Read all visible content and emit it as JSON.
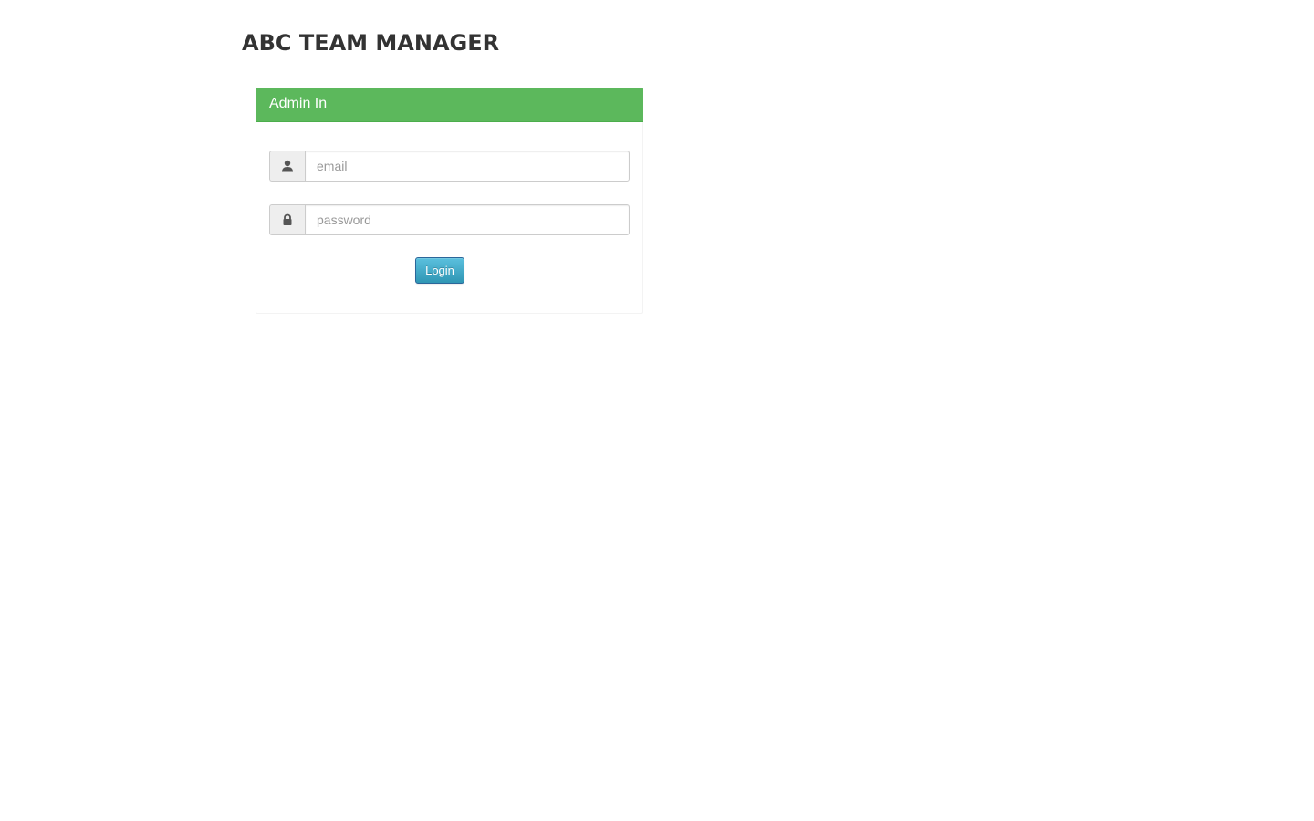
{
  "app": {
    "title": "ABC TEAM MANAGER"
  },
  "login_panel": {
    "heading": "Admin In",
    "heading_color": "#5cb85c",
    "email": {
      "placeholder": "email",
      "value": "",
      "icon": "user-icon"
    },
    "password": {
      "placeholder": "password",
      "value": "",
      "icon": "lock-icon"
    },
    "login_button": {
      "label": "Login",
      "color": "#2f96b4"
    }
  }
}
